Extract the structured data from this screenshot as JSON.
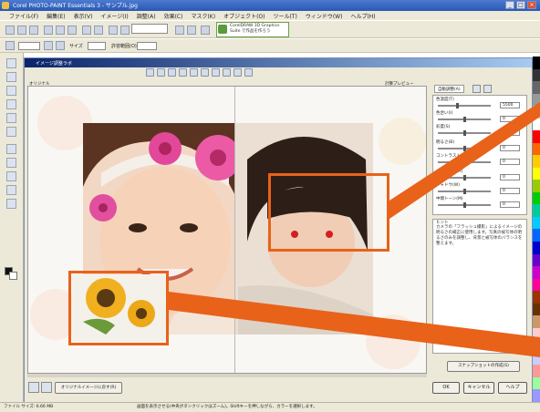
{
  "window": {
    "title": "Corel PHOTO-PAINT Essentials 3 - サンプル.jpg"
  },
  "menu": {
    "items": [
      "ファイル(F)",
      "編集(E)",
      "表示(V)",
      "イメージ(I)",
      "調整(A)",
      "効果(C)",
      "マスク(K)",
      "オブジェクト(O)",
      "ツール(T)",
      "ウィンドウ(W)",
      "ヘルプ(H)"
    ]
  },
  "toolbar": {
    "promo_text": "CorelDRAW 3D Graphics Suite で作品を作ろう",
    "size_label": "サイズ",
    "tolerance_label": "許容範囲(O)"
  },
  "dialog": {
    "title": "イメージ調整ラボ",
    "original_label": "オリジナル",
    "preview_label": "計算プレビュー",
    "tabs": [
      "自動調整(A)"
    ],
    "sliders": [
      {
        "label": "色温度(T)",
        "value": "5500"
      },
      {
        "label": "色合い(I)",
        "value": "0"
      },
      {
        "label": "彩度(S)",
        "value": "0"
      },
      {
        "label": "明るさ(B)",
        "value": "0"
      },
      {
        "label": "コントラスト(C)",
        "value": "0"
      },
      {
        "label": "ハイライト(H)",
        "value": "0"
      },
      {
        "label": "シャドウ(W)",
        "value": "0"
      },
      {
        "label": "中間トーン(M)",
        "value": "0"
      }
    ],
    "hint_title": "ヒント",
    "hint_text": "カメラの「フラッシュ撮影」によるイメージの明るさの補正に使用します。写真の被写体の明るさのみを調整し、背景と被写体のバランスを整えます。",
    "selection_mode_label": "スナップショットの作成(S)",
    "origin_toggle_label": "オリジナルイメージに戻す(R)",
    "ok_label": "OK",
    "cancel_label": "キャンセル",
    "help_label": "ヘルプ"
  },
  "status": {
    "left": "ファイル サイズ: 6.66 MB",
    "message": "画面を表示させる(中央ボタンクリックはズーム)。Shiftキーを押しながら、カラーを選択します。"
  },
  "colors": {
    "callout": "#e8621a",
    "palette": [
      "#000000",
      "#333333",
      "#666666",
      "#999999",
      "#cccccc",
      "#ffffff",
      "#ff0000",
      "#ff6600",
      "#ffcc00",
      "#ffff00",
      "#99cc00",
      "#00cc00",
      "#00cc99",
      "#00ccff",
      "#0066ff",
      "#0000cc",
      "#6600cc",
      "#cc00cc",
      "#ff0099",
      "#993300",
      "#663300",
      "#cc9966",
      "#ffcccc",
      "#ccffcc",
      "#ccccff",
      "#ff9999",
      "#99ff99",
      "#9999ff"
    ]
  }
}
